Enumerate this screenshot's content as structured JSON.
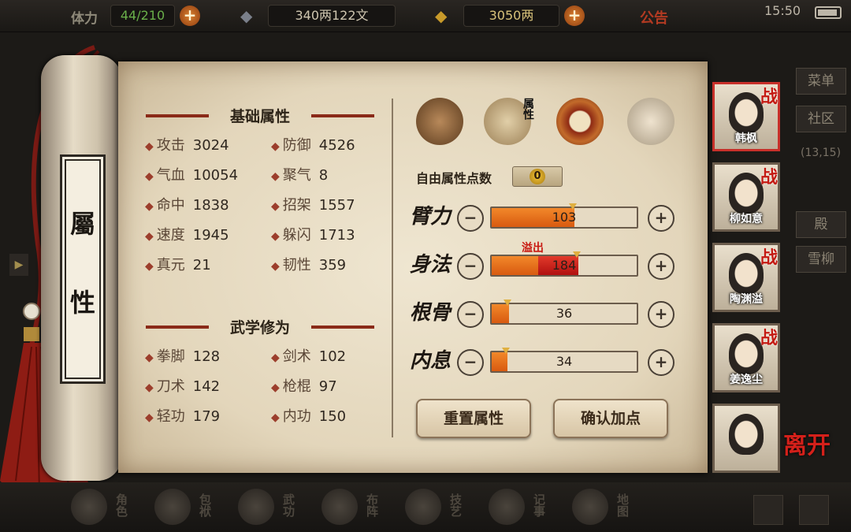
{
  "topbar": {
    "stamina_label": "体力",
    "stamina_value": "44/210",
    "silver_value": "340两122文",
    "gold_value": "3050两",
    "notice_label": "公告",
    "time": "15:50"
  },
  "side_menu": {
    "menu_label": "菜单",
    "community_label": "社区",
    "coords": "13,15",
    "item_a": "殿",
    "item_b": "雪柳"
  },
  "scroll": {
    "title_chars": [
      "屬",
      "性"
    ]
  },
  "basic_attributes": {
    "header": "基础属性",
    "stats": [
      {
        "label": "攻击",
        "value": "3024"
      },
      {
        "label": "防御",
        "value": "4526"
      },
      {
        "label": "气血",
        "value": "10054"
      },
      {
        "label": "聚气",
        "value": "8"
      },
      {
        "label": "命中",
        "value": "1838"
      },
      {
        "label": "招架",
        "value": "1557"
      },
      {
        "label": "速度",
        "value": "1945"
      },
      {
        "label": "躲闪",
        "value": "1713"
      },
      {
        "label": "真元",
        "value": "21"
      },
      {
        "label": "韧性",
        "value": "359"
      }
    ]
  },
  "martial": {
    "header": "武学修为",
    "stats": [
      {
        "label": "拳脚",
        "value": "128"
      },
      {
        "label": "剑术",
        "value": "102"
      },
      {
        "label": "刀术",
        "value": "142"
      },
      {
        "label": "枪棍",
        "value": "97"
      },
      {
        "label": "轻功",
        "value": "179"
      },
      {
        "label": "内功",
        "value": "150"
      }
    ]
  },
  "tabs": {
    "attribute_tab_label": "属性"
  },
  "allocation": {
    "free_points_label": "自由属性点数",
    "free_points_value": "0",
    "overflow_label": "溢出",
    "attributes": [
      {
        "name": "臂力",
        "value": "103",
        "fill": 0.57,
        "overflow": 0
      },
      {
        "name": "身法",
        "value": "184",
        "fill": 0.32,
        "overflow": 0.28
      },
      {
        "name": "根骨",
        "value": "36",
        "fill": 0.12,
        "overflow": 0
      },
      {
        "name": "内息",
        "value": "34",
        "fill": 0.11,
        "overflow": 0
      }
    ],
    "reset_label": "重置属性",
    "confirm_label": "确认加点"
  },
  "party": {
    "battle_mark": "战",
    "members": [
      {
        "name": "韩枫",
        "in_battle": true
      },
      {
        "name": "柳如意",
        "in_battle": true
      },
      {
        "name": "陶渊溢",
        "in_battle": true
      },
      {
        "name": "姜逸尘",
        "in_battle": true
      },
      {
        "name": "",
        "in_battle": false
      }
    ],
    "leave_label": "离开"
  },
  "bottom_nav": {
    "items": [
      "角色",
      "包袱",
      "武功",
      "布阵",
      "技艺",
      "记事",
      "地图"
    ]
  },
  "colors": {
    "accent_orange": "#e26a14",
    "overflow_red": "#c81a12",
    "paper": "#e9dec6",
    "ink": "#2d2418"
  }
}
